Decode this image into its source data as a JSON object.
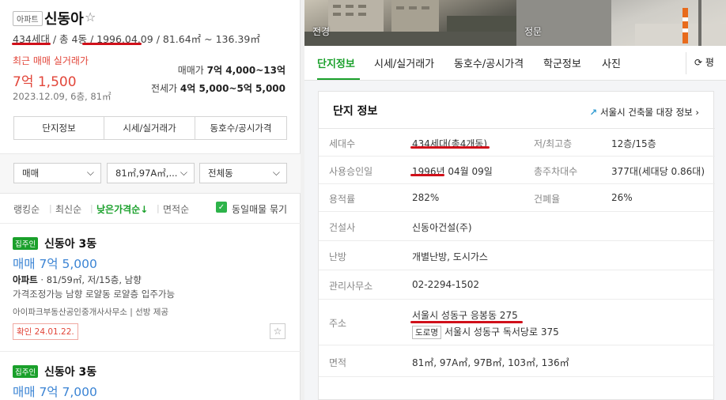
{
  "left": {
    "type_badge": "아파트",
    "apartment_name": "신동아",
    "star": "☆",
    "info": {
      "households": "434세대",
      "sep1": " / ",
      "buildings": "총 4동",
      "sep2": " / ",
      "approval_date": "1996.04.09",
      "sep3": " / ",
      "area_range": "81.64㎡ ~ 136.39㎡"
    },
    "recent_label": "최근 매매 실거래가",
    "recent_price": "7억 1,500",
    "recent_meta": "2023.12.09, 6층, 81㎡",
    "sale_label": "매매가",
    "sale_value": "7억 4,000~13억",
    "jeonse_label": "전세가",
    "jeonse_value": "4억 5,000~5억 5,000",
    "buttons": [
      "단지정보",
      "시세/실거래가",
      "동호수/공시가격"
    ],
    "filters": {
      "trade_type": "매매",
      "area": "81㎡,97A㎡,...",
      "building": "전체동"
    },
    "sorts": [
      "랭킹순",
      "최신순",
      "낮은가격순↓",
      "면적순"
    ],
    "same_listing_label": "동일매물 묶기",
    "listings": [
      {
        "badge": "집주인",
        "title": "신동아 3동",
        "price": "매매 7억 5,000",
        "spec_type": "아파트",
        "spec_rest": " · 81/59㎡, 저/15층, 남향",
        "desc": "가격조정가능 남향 로얄동 로얄층 입주가능",
        "agent": "아이파크부동산공인중개사사무소  |  선방 제공",
        "confirm": "확인 24.01.22."
      },
      {
        "badge": "집주인",
        "title": "신동아 3동",
        "price": "매매 7억 7,000"
      }
    ]
  },
  "right": {
    "photos": [
      "전경",
      "정문"
    ],
    "tabs": [
      "단지정보",
      "시세/실거래가",
      "동호수/공시가격",
      "학군정보",
      "사진"
    ],
    "refresh_label": "평",
    "card_title": "단지 정보",
    "card_link": "서울시 건축물 대장 정보",
    "rows": {
      "households_label": "세대수",
      "households_value": "434세대(총4개동)",
      "floors_label": "저/최고층",
      "floors_value": "12층/15층",
      "approval_label": "사용승인일",
      "approval_value": "1996년 04월 09일",
      "parking_label": "총주차대수",
      "parking_value": "377대(세대당 0.86대)",
      "far_label": "용적률",
      "far_value": "282%",
      "bcr_label": "건폐율",
      "bcr_value": "26%",
      "builder_label": "건설사",
      "builder_value": "신동아건설(주)",
      "heating_label": "난방",
      "heating_value": "개별난방, 도시가스",
      "office_label": "관리사무소",
      "office_value": "02-2294-1502",
      "address_label": "주소",
      "address_value": "서울시 성동구 응봉동 275",
      "road_tag": "도로명",
      "road_value": "서울시 성동구 독서당로 375",
      "area_label": "면적",
      "area_value": "81㎡, 97A㎡, 97B㎡, 103㎡, 136㎡"
    }
  },
  "colors": {
    "accent_green": "#1aa02b",
    "price_red": "#e2463a",
    "price_blue": "#3b84d4",
    "annotation_red": "#d0101a"
  }
}
